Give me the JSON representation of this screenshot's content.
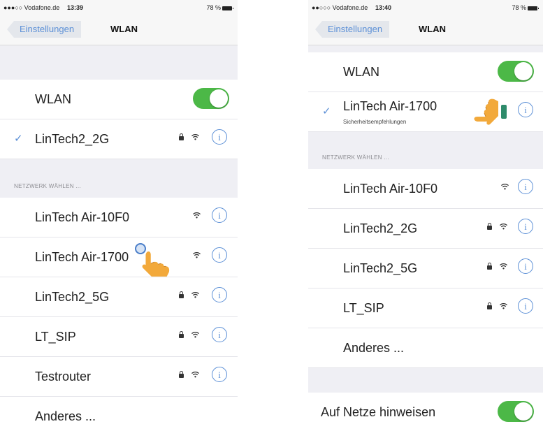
{
  "left_screen": {
    "status": {
      "carrier": "●●●○○ Vodafone.de",
      "time": "13:39",
      "battery": "78 %"
    },
    "nav": {
      "back_label": "Einstellungen",
      "title": "WLAN"
    },
    "wlan_row": {
      "label": "WLAN",
      "toggle_on": true
    },
    "connected": {
      "name": "LinTech2_2G",
      "secured": true
    },
    "section_header": "NETZWERK WÄHLEN ...",
    "networks": [
      {
        "name": "LinTech Air-10F0",
        "secured": false
      },
      {
        "name": "LinTech Air-1700",
        "secured": false
      },
      {
        "name": "LinTech2_5G",
        "secured": true
      },
      {
        "name": "LT_SIP",
        "secured": true
      },
      {
        "name": "Testrouter",
        "secured": true
      }
    ],
    "other_label": "Anderes ..."
  },
  "right_screen": {
    "status": {
      "carrier": "●●○○○ Vodafone.de",
      "time": "13:40",
      "battery": "78 %"
    },
    "nav": {
      "back_label": "Einstellungen",
      "title": "WLAN"
    },
    "wlan_row": {
      "label": "WLAN",
      "toggle_on": true
    },
    "connected": {
      "name": "LinTech Air-1700",
      "subtitle": "Sicherheitsempfehlungen"
    },
    "section_header": "NETZWERK WÄHLEN ...",
    "networks": [
      {
        "name": "LinTech Air-10F0",
        "secured": false
      },
      {
        "name": "LinTech2_2G",
        "secured": true
      },
      {
        "name": "LinTech2_5G",
        "secured": true
      },
      {
        "name": "LT_SIP",
        "secured": true
      }
    ],
    "other_label": "Anderes ...",
    "notify_row": {
      "label": "Auf Netze hinweisen",
      "toggle_on": true
    }
  },
  "colors": {
    "accent": "#5b8fd6",
    "toggle_green": "#4cb847",
    "background": "#efeff4"
  },
  "icons": [
    "wifi-icon",
    "lock-icon",
    "info-icon",
    "checkmark-icon",
    "pointing-hand-icon"
  ]
}
